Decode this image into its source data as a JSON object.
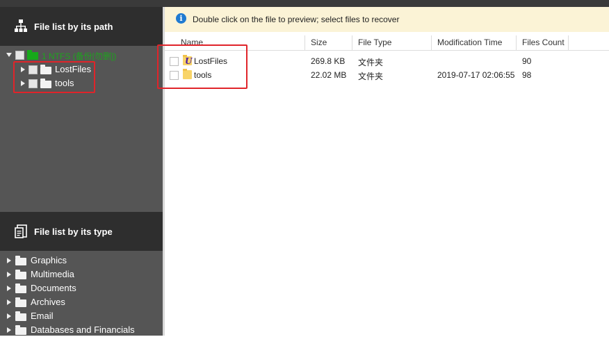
{
  "sidebar": {
    "path_heading": "File list by its path",
    "type_heading": "File list by its type",
    "tree": {
      "root_label": "1 NTFS (备份[勿删])",
      "children": [
        {
          "label": "LostFiles"
        },
        {
          "label": "tools"
        }
      ]
    },
    "types": [
      {
        "label": "Graphics"
      },
      {
        "label": "Multimedia"
      },
      {
        "label": "Documents"
      },
      {
        "label": "Archives"
      },
      {
        "label": "Email"
      },
      {
        "label": "Databases and Financials"
      }
    ],
    "colors": {
      "background": "#555555",
      "heading": "#2e2e2e",
      "root_text": "#1ea41e"
    }
  },
  "info_bar": {
    "message": "Double click on the file to preview; select files to recover"
  },
  "file_table": {
    "columns": [
      "Name",
      "Size",
      "File Type",
      "Modification Time",
      "Files Count"
    ],
    "rows": [
      {
        "name": "LostFiles",
        "size": "269.8 KB",
        "type": "文件夹",
        "modified": "",
        "count": "90",
        "icon": "lost-files-folder-icon"
      },
      {
        "name": "tools",
        "size": "22.02 MB",
        "type": "文件夹",
        "modified": "2019-07-17 02:06:55",
        "count": "98",
        "icon": "folder-icon"
      }
    ]
  },
  "accent": {
    "highlight_box": "#e0242a",
    "info_background": "#fbf3d6"
  }
}
